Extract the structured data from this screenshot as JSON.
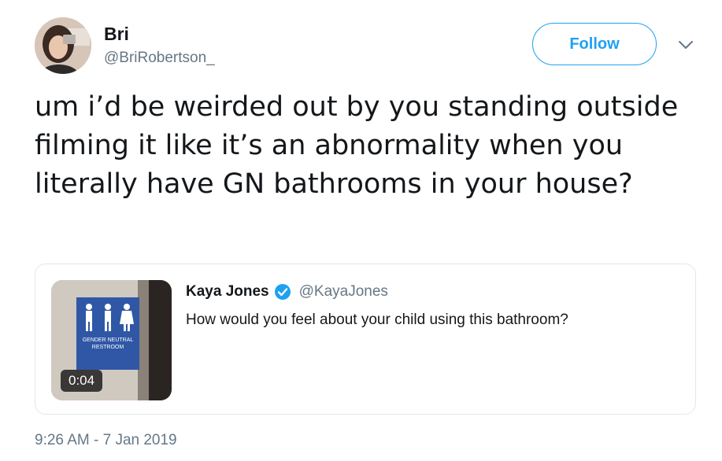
{
  "tweet": {
    "author": {
      "name": "Bri",
      "handle": "@BriRobertson_"
    },
    "follow_label": "Follow",
    "text": "um i’d be weirded out by you standing outside filming it like it’s an abnormality when you literally have GN bathrooms in your house?",
    "timestamp": "9:26 AM - 7 Jan 2019"
  },
  "quoted_tweet": {
    "author": {
      "name": "Kaya Jones",
      "handle": "@KayaJones",
      "verified": true
    },
    "text": "How would you feel about your child using this bathroom?",
    "media": {
      "type": "video",
      "duration": "0:04",
      "sign_text": [
        "GENDER NEUTRAL",
        "RESTROOM"
      ]
    }
  },
  "colors": {
    "accent": "#1da1f2",
    "secondary_text": "#657786",
    "primary_text": "#14171a",
    "border": "#e1e8ed"
  },
  "icons": {
    "caret": "chevron-down-icon",
    "verified": "verified-badge-icon"
  }
}
